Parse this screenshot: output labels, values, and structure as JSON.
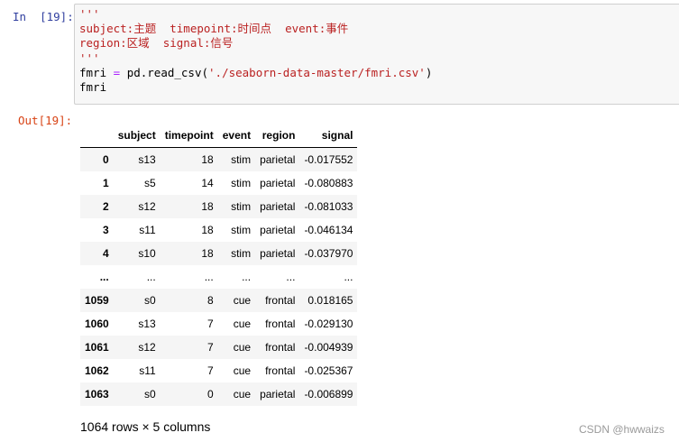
{
  "input_prompt": "In  [19]:",
  "output_prompt": "Out[19]:",
  "code": {
    "doc_open": "'''",
    "line1": "subject:主题  timepoint:时间点  event:事件",
    "line2": "region:区域  signal:信号",
    "doc_close": "'''",
    "line5_var": "fmri",
    "line5_eq": "=",
    "line5_call": "pd.read_csv(",
    "line5_str": "'./seaborn-data-master/fmri.csv'",
    "line5_end": ")",
    "line6": "fmri"
  },
  "table": {
    "columns": [
      "",
      "subject",
      "timepoint",
      "event",
      "region",
      "signal"
    ],
    "rows": [
      [
        "0",
        "s13",
        "18",
        "stim",
        "parietal",
        "-0.017552"
      ],
      [
        "1",
        "s5",
        "14",
        "stim",
        "parietal",
        "-0.080883"
      ],
      [
        "2",
        "s12",
        "18",
        "stim",
        "parietal",
        "-0.081033"
      ],
      [
        "3",
        "s11",
        "18",
        "stim",
        "parietal",
        "-0.046134"
      ],
      [
        "4",
        "s10",
        "18",
        "stim",
        "parietal",
        "-0.037970"
      ],
      [
        "...",
        "...",
        "...",
        "...",
        "...",
        "..."
      ],
      [
        "1059",
        "s0",
        "8",
        "cue",
        "frontal",
        "0.018165"
      ],
      [
        "1060",
        "s13",
        "7",
        "cue",
        "frontal",
        "-0.029130"
      ],
      [
        "1061",
        "s12",
        "7",
        "cue",
        "frontal",
        "-0.004939"
      ],
      [
        "1062",
        "s11",
        "7",
        "cue",
        "frontal",
        "-0.025367"
      ],
      [
        "1063",
        "s0",
        "0",
        "cue",
        "parietal",
        "-0.006899"
      ]
    ]
  },
  "summary": "1064 rows × 5 columns",
  "watermark": "CSDN @hwwaizs",
  "colors": {
    "in_prompt": "#303f9f",
    "out_prompt": "#d84315",
    "string": "#ba2121",
    "operator": "#aa22ff",
    "cell_bg": "#f7f7f7",
    "row_stripe": "#f5f5f5"
  }
}
